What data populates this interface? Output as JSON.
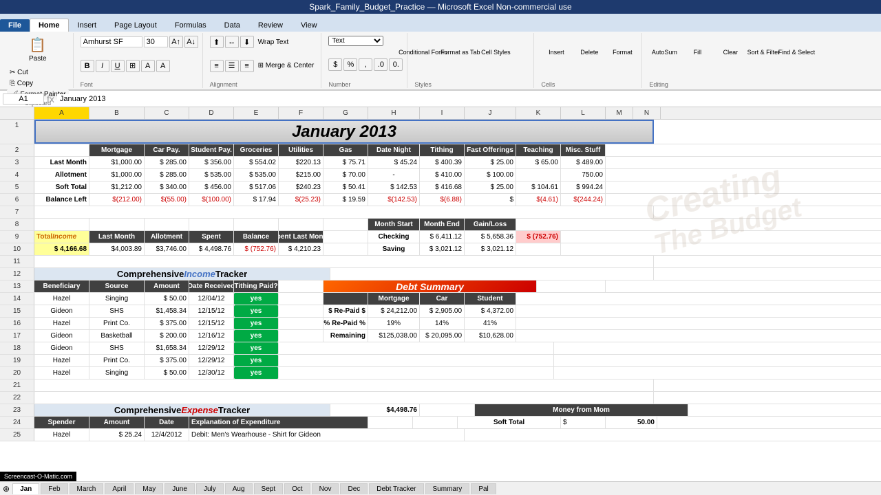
{
  "titleBar": {
    "text": "Spark_Family_Budget_Practice — Microsoft Excel Non-commercial use"
  },
  "ribbonTabs": [
    "File",
    "Home",
    "Insert",
    "Page Layout",
    "Formulas",
    "Data",
    "Review",
    "View"
  ],
  "activeTab": "Home",
  "toolbar": {
    "clipboard": {
      "label": "Clipboard",
      "paste": "Paste",
      "cut": "Cut",
      "copy": "Copy",
      "formatPainter": "Format Painter"
    },
    "font": {
      "label": "Font",
      "name": "Amhurst SF",
      "size": "30",
      "bold": "B",
      "italic": "I",
      "underline": "U"
    },
    "alignment": {
      "label": "Alignment",
      "wrapText": "Wrap Text",
      "mergeCenter": "Merge & Center"
    },
    "number": {
      "label": "Number",
      "format": "Text"
    }
  },
  "formulaBar": {
    "cellRef": "A1",
    "formula": "January 2013"
  },
  "columns": [
    "A",
    "B",
    "C",
    "D",
    "E",
    "F",
    "G",
    "H",
    "I",
    "J",
    "K",
    "L",
    "M",
    "N"
  ],
  "sheetTabs": [
    "Jan",
    "Feb",
    "March",
    "April",
    "May",
    "June",
    "July",
    "Aug",
    "Sept",
    "Oct",
    "Nov",
    "Dec",
    "Debt Tracker",
    "Summary",
    "Pal"
  ],
  "activeSheet": "Jan",
  "spreadsheet": {
    "title": "January 2013",
    "headers": {
      "row2": [
        "",
        "Mortgage",
        "Car Pay.",
        "Student Pay.",
        "Groceries",
        "Utilities",
        "Gas",
        "Date Night",
        "Tithing",
        "Fast Offerings",
        "Teaching",
        "Misc. Stuff"
      ]
    },
    "rows": {
      "row3": [
        "Last Month",
        "$1,000.00",
        "$  285.00",
        "$  356.00",
        "$  554.02",
        "$220.13",
        "$  75.71",
        "$  45.24",
        "$  400.39",
        "$  25.00",
        "$  65.00",
        "$  489.00"
      ],
      "row4": [
        "Allotment",
        "$1,000.00",
        "$  285.00",
        "$  535.00",
        "$  535.00",
        "$215.00",
        "$  70.00",
        "-",
        "$  410.00",
        "$  100.00",
        ""
      ],
      "row5": [
        "Soft Total",
        "$1,212.00",
        "$  340.00",
        "$  456.00",
        "$  517.06",
        "$240.23",
        "$  50.41",
        "$  142.53",
        "$  416.68",
        "$  25.00",
        "$  104.61",
        "$  994.24"
      ],
      "row6": [
        "Balance Left",
        "$(212.00)",
        "$(55.00)",
        "$(100.00)",
        "$  17.94",
        "$(25.23)",
        "$  19.59",
        "$(142.53)",
        "$(6.88)",
        "$",
        "$(4.61)",
        "$(244.24)"
      ]
    },
    "incomeSection": {
      "row9headers": [
        "Total Income",
        "Last Month",
        "Allotment",
        "Spent",
        "Balance",
        "Spent Last Month",
        "",
        "Month Start",
        "Month End",
        "Gain/Loss"
      ],
      "row10": [
        "$  4,166.68",
        "$4,003.89",
        "$3,746.00",
        "$  4,498.76",
        "$  (752.76)",
        "$  4,210.23",
        "",
        "Checking",
        "$  6,411.12",
        "$  5,658.36",
        "$(752.76)"
      ],
      "row10savings": [
        "Saving",
        "$  3,021.12",
        "$  3,021.12"
      ]
    },
    "comprehensiveIncome": {
      "title": "Comprehensive Income Tracker",
      "headers": [
        "Beneficiary",
        "Source",
        "Amount",
        "Date Received",
        "Tithing Paid?"
      ],
      "rows": [
        [
          "Hazel",
          "Singing",
          "$  50.00",
          "12/04/12",
          "yes"
        ],
        [
          "Gideon",
          "SHS",
          "$1,458.34",
          "12/15/12",
          "yes"
        ],
        [
          "Hazel",
          "Print Co.",
          "$  375.00",
          "12/15/12",
          "yes"
        ],
        [
          "Gideon",
          "Basketball",
          "$  200.00",
          "12/16/12",
          "yes"
        ],
        [
          "Gideon",
          "SHS",
          "$1,658.34",
          "12/29/12",
          "yes"
        ],
        [
          "Hazel",
          "Print Co.",
          "$  375.00",
          "12/29/12",
          "yes"
        ],
        [
          "Hazel",
          "Singing",
          "$  50.00",
          "12/30/12",
          "yes"
        ]
      ]
    },
    "debtSummary": {
      "title": "Debt Summary",
      "headers": [
        "",
        "Mortgage",
        "Car",
        "Student"
      ],
      "rows": [
        [
          "$ Re-Paid $",
          "$  24,212.00",
          "$  2,905.00",
          "$  4,372.00"
        ],
        [
          "% Re-Paid %",
          "19%",
          "14%",
          "41%"
        ],
        [
          "Remaining",
          "$125,038.00",
          "$  20,095.00",
          "$10,628.00"
        ]
      ]
    },
    "comprehensiveExpense": {
      "title": "Comprehensive Expense Tracker",
      "total": "$4,498.76",
      "headers": [
        "Spender",
        "Amount",
        "Date",
        "Explanation of Expenditure"
      ],
      "rows": [
        [
          "Hazel",
          "$  25.24",
          "12/4/2012",
          "Debit: Men's Wearhouse - Shirt for Gideon"
        ]
      ]
    },
    "moneyFromMom": {
      "title": "Money from Mom",
      "softTotal": "Soft Total",
      "amount": "$ 50.00"
    }
  }
}
